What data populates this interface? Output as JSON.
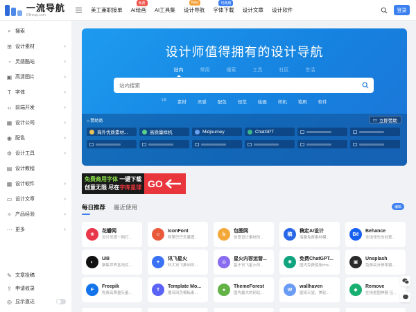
{
  "header": {
    "logo_title": "一流导航",
    "logo_sub": "Dfinesp.com",
    "nav": [
      {
        "label": "美工兼职接单",
        "badge": ""
      },
      {
        "label": "AI绘画",
        "badge": "免费"
      },
      {
        "label": "AI工具集",
        "badge": ""
      },
      {
        "label": "设计导航",
        "badge": "New"
      },
      {
        "label": "字体下载",
        "badge": "可商用"
      },
      {
        "label": "设计文章",
        "badge": ""
      },
      {
        "label": "设计软件",
        "badge": ""
      }
    ],
    "login_label": "登录"
  },
  "sidebar": {
    "items": [
      {
        "label": "搜索",
        "icon": "search-icon",
        "chevron": false
      },
      {
        "label": "设计素材",
        "icon": "grid-icon",
        "chevron": true
      },
      {
        "label": "灵感酷站",
        "icon": "bulb-icon",
        "chevron": true
      },
      {
        "label": "高清图片",
        "icon": "image-icon",
        "chevron": true
      },
      {
        "label": "字体",
        "icon": "font-icon",
        "chevron": true
      },
      {
        "label": "前端开发",
        "icon": "code-icon",
        "chevron": true
      },
      {
        "label": "设计公司",
        "icon": "building-icon",
        "chevron": true
      },
      {
        "label": "配色",
        "icon": "palette-icon",
        "chevron": true
      },
      {
        "label": "设计工具",
        "icon": "gear-icon",
        "chevron": true
      },
      {
        "label": "设计教程",
        "icon": "book-icon",
        "chevron": false
      },
      {
        "label": "设计软件",
        "icon": "app-icon",
        "chevron": true
      },
      {
        "label": "设计文章",
        "icon": "document-icon",
        "chevron": true
      },
      {
        "label": "产品经验",
        "icon": "star-icon",
        "chevron": true
      },
      {
        "label": "更多",
        "icon": "more-icon",
        "chevron": true
      }
    ],
    "bottom": [
      {
        "label": "文章投稿",
        "icon": "edit-icon"
      },
      {
        "label": "申请收录",
        "icon": "upload-icon"
      },
      {
        "label": "显示直达",
        "icon": "eye-icon"
      }
    ]
  },
  "hero": {
    "title": "设计师值得拥有的设计导航",
    "tabs": [
      "站内",
      "常用",
      "搜索",
      "工具",
      "社区",
      "生活"
    ],
    "search_placeholder": "站内搜索",
    "links": [
      "UI",
      "素材",
      "灵感",
      "配色",
      "规范",
      "绘画",
      "样机",
      "笔刷",
      "软件"
    ],
    "sponsor_title": "赞助商",
    "download_label": "立即赞助",
    "sponsors": [
      "海外优质素材...",
      "高质量样机",
      "Midjourney",
      "ChatGPT"
    ]
  },
  "ad": {
    "line1_a": "免费商用字体",
    "line1_b": "一键下载",
    "line2_a": "创意无限",
    "line2_b": "尽在",
    "line2_c": "字库星球",
    "go": "GO"
  },
  "section": {
    "tabs": [
      "每日推荐",
      "最近使用"
    ],
    "more_label": "编辑"
  },
  "cards": [
    {
      "name": "花瓣网",
      "desc": "设计灵感一网打...",
      "color": "#e8364a",
      "glyph": "❀"
    },
    {
      "name": "IconFont",
      "desc": "阿里巴巴矢量图...",
      "color": "#e95a3b",
      "glyph": "☺"
    },
    {
      "name": "包图网",
      "desc": "创意设计素材的...",
      "color": "#f4a83a",
      "glyph": "b"
    },
    {
      "name": "稿定AI设计",
      "desc": "海量免费素材模...",
      "color": "#2767e8",
      "glyph": "稿"
    },
    {
      "name": "Behance",
      "desc": "全球领先的创意...",
      "color": "#1760f0",
      "glyph": "Bē"
    },
    {
      "name": "UI8",
      "desc": "聚集世界各地优...",
      "color": "#111111",
      "glyph": "◐"
    },
    {
      "name": "讯飞星火",
      "desc": "科大讯飞推出的...",
      "color": "#3a72f5",
      "glyph": "✦"
    },
    {
      "name": "星火内容运营...",
      "desc": "基于讯飞星火的...",
      "color": "#8a6cf0",
      "glyph": "◎"
    },
    {
      "name": "免费ChatGPT...",
      "desc": "国内免费使用cha...",
      "color": "#10a37f",
      "glyph": "✺"
    },
    {
      "name": "Unsplash",
      "desc": "免费高分辨率摄...",
      "color": "#2a2a2a",
      "glyph": "▣"
    },
    {
      "name": "Freepik",
      "desc": "免费高质量矢量...",
      "color": "#1273eb",
      "glyph": "F"
    },
    {
      "name": "Template Mo...",
      "desc": "著名网页模板素...",
      "color": "#5a63f5",
      "glyph": "T"
    },
    {
      "name": "ThemeForest",
      "desc": "国内最大的网站...",
      "color": "#62b246",
      "glyph": "●"
    },
    {
      "name": "wallhaven",
      "desc": "壁纸天堂，美轮...",
      "color": "#6b9cf5",
      "glyph": "W"
    },
    {
      "name": "Remove",
      "desc": "在线抠图神器·压...",
      "color": "#18b070",
      "glyph": "◆"
    }
  ]
}
